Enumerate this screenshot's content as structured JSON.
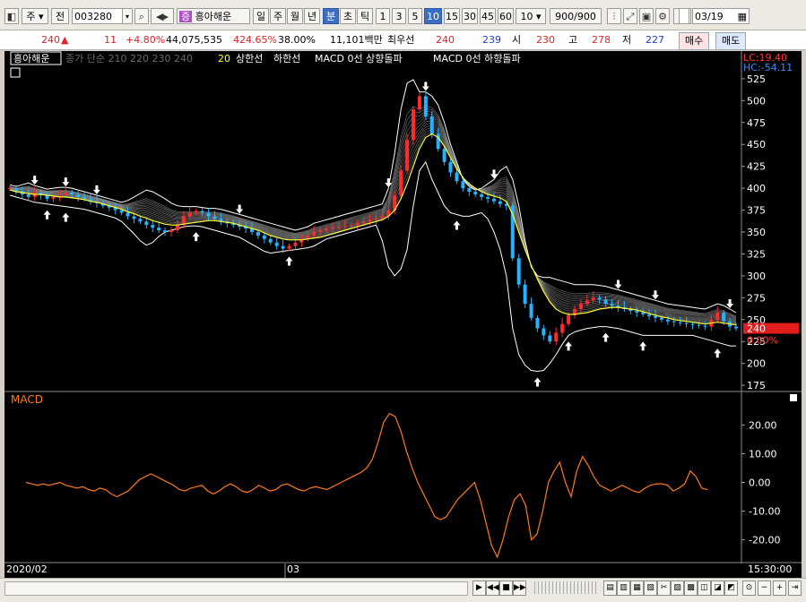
{
  "toolbar": {
    "market_select": "주",
    "prev_label": "전",
    "code_value": "003280",
    "stock_name": "흥아해운",
    "stock_badge": "증",
    "period_buttons": [
      "일",
      "주",
      "월",
      "년"
    ],
    "type_buttons": [
      "분",
      "초",
      "틱"
    ],
    "type_selected": "분",
    "interval_buttons": [
      "1",
      "3",
      "5",
      "10",
      "15",
      "30",
      "45",
      "60"
    ],
    "interval_selected": "10",
    "interval_select_value": "10",
    "count_display": "900/900",
    "date_value": "03/19"
  },
  "quote": {
    "price": "240",
    "change_arrow": "▲",
    "change": "11",
    "change_pct": "+4.80%",
    "volume": "44,075,535",
    "volume_ratio": "424.65%",
    "turnover": "38.00%",
    "amount": "11,101백만",
    "best_bid_label": "최우선",
    "best_ask": "240",
    "best_bid": "239",
    "open_label": "시",
    "open": "230",
    "high_label": "고",
    "high": "278",
    "low_label": "저",
    "low": "227",
    "buy_button": "매수",
    "sell_button": "매도"
  },
  "chart_data": [
    {
      "type": "candlestick",
      "panel": "price",
      "legend": [
        "흥아해운",
        "종가 단순 210",
        "220",
        "230",
        "240",
        "20",
        "상한선",
        "하한선",
        "MACD 0선 상향돌파",
        "MACD 0선 하향돌파"
      ],
      "hc_lc": [
        "LC:19.40",
        "HC:-54.11"
      ],
      "ylim": [
        170,
        530
      ],
      "yticks": [
        175,
        200,
        225,
        250,
        275,
        300,
        325,
        350,
        375,
        400,
        425,
        450,
        475,
        500,
        525
      ],
      "current_price_tag": "240",
      "current_pct_tag": "0.00%",
      "close_series": [
        400,
        397,
        393,
        390,
        395,
        392,
        388,
        390,
        392,
        395,
        393,
        390,
        388,
        385,
        383,
        380,
        378,
        375,
        372,
        368,
        365,
        362,
        358,
        355,
        352,
        350,
        352,
        358,
        368,
        372,
        374,
        372,
        368,
        365,
        362,
        360,
        358,
        356,
        354,
        350,
        346,
        342,
        338,
        334,
        331,
        334,
        338,
        342,
        346,
        350,
        352,
        354,
        355,
        356,
        357,
        358,
        360,
        362,
        364,
        366,
        368,
        375,
        392,
        420,
        455,
        490,
        505,
        482,
        462,
        445,
        430,
        418,
        408,
        400,
        396,
        393,
        390,
        388,
        385,
        382,
        380,
        320,
        290,
        268,
        252,
        240,
        232,
        225,
        235,
        245,
        255,
        262,
        268,
        272,
        275,
        273,
        268,
        266,
        264,
        262,
        260,
        258,
        256,
        254,
        252,
        250,
        248,
        247,
        246,
        245,
        244,
        243,
        242,
        250,
        258,
        248,
        242,
        240
      ],
      "ma20_series": [
        398,
        396,
        395,
        394,
        393,
        393,
        392,
        391,
        390,
        390,
        389,
        388,
        387,
        385,
        384,
        382,
        380,
        378,
        376,
        373,
        371,
        368,
        366,
        363,
        361,
        359,
        358,
        358,
        359,
        360,
        361,
        362,
        363,
        363,
        362,
        361,
        360,
        358,
        356,
        354,
        352,
        349,
        346,
        344,
        342,
        341,
        341,
        341,
        342,
        343,
        344,
        346,
        348,
        350,
        352,
        354,
        356,
        358,
        360,
        362,
        364,
        368,
        375,
        388,
        405,
        425,
        445,
        458,
        462,
        458,
        448,
        435,
        422,
        412,
        405,
        400,
        396,
        393,
        391,
        389,
        385,
        370,
        350,
        330,
        312,
        296,
        282,
        270,
        262,
        258,
        256,
        256,
        257,
        258,
        260,
        262,
        263,
        264,
        264,
        263,
        262,
        261,
        259,
        257,
        255,
        253,
        252,
        250,
        249,
        248,
        247,
        246,
        245,
        246,
        247,
        246,
        245,
        244
      ],
      "upper_band": [
        404,
        402,
        404,
        406,
        403,
        401,
        399,
        400,
        401,
        401,
        400,
        398,
        396,
        394,
        392,
        390,
        388,
        386,
        384,
        386,
        390,
        394,
        398,
        396,
        392,
        388,
        383,
        380,
        379,
        379,
        379,
        378,
        377,
        377,
        376,
        374,
        372,
        370,
        368,
        366,
        364,
        362,
        360,
        358,
        356,
        354,
        352,
        354,
        356,
        360,
        362,
        364,
        366,
        368,
        370,
        372,
        374,
        376,
        378,
        380,
        382,
        400,
        440,
        490,
        520,
        524,
        510,
        510,
        505,
        495,
        475,
        450,
        430,
        410,
        402,
        398,
        400,
        405,
        410,
        420,
        425,
        410,
        380,
        340,
        310,
        300,
        298,
        298,
        296,
        294,
        292,
        290,
        290,
        290,
        290,
        289,
        288,
        286,
        284,
        282,
        280,
        278,
        276,
        274,
        272,
        270,
        268,
        267,
        266,
        265,
        264,
        263,
        262,
        265,
        268,
        266,
        262,
        258
      ],
      "lower_band": [
        392,
        390,
        388,
        386,
        384,
        383,
        382,
        381,
        380,
        379,
        378,
        377,
        376,
        374,
        372,
        370,
        368,
        366,
        362,
        355,
        348,
        340,
        335,
        338,
        345,
        350,
        352,
        354,
        356,
        357,
        357,
        356,
        354,
        352,
        350,
        348,
        346,
        344,
        340,
        336,
        332,
        328,
        326,
        327,
        328,
        329,
        330,
        331,
        332,
        334,
        338,
        342,
        344,
        346,
        348,
        350,
        352,
        354,
        356,
        358,
        340,
        310,
        300,
        308,
        330,
        380,
        420,
        430,
        410,
        395,
        380,
        372,
        370,
        368,
        368,
        370,
        372,
        365,
        350,
        330,
        300,
        240,
        210,
        198,
        192,
        191,
        192,
        200,
        210,
        222,
        232,
        236,
        238,
        240,
        241,
        242,
        242,
        241,
        240,
        238,
        236,
        234,
        232,
        232,
        232,
        232,
        232,
        232,
        232,
        232,
        232,
        230,
        228,
        226,
        224,
        222,
        220,
        220
      ],
      "buy_signals": [
        6,
        9,
        30,
        45,
        72,
        85,
        90,
        96,
        102,
        114
      ],
      "sell_signals": [
        4,
        9,
        14,
        37,
        61,
        67,
        78,
        98,
        104,
        116
      ]
    },
    {
      "type": "line",
      "panel": "macd",
      "title": "MACD",
      "ylim": [
        -27,
        27
      ],
      "yticks": [
        20,
        10,
        0,
        -10,
        -20
      ],
      "ytick_labels": [
        "20.00",
        "10.00",
        "0.00",
        "-10.00",
        "-20.00"
      ],
      "color": "#ff7a1a",
      "values": [
        0,
        -0.5,
        -1,
        -0.5,
        -1,
        -0.5,
        0,
        -1,
        -1.5,
        -2,
        -1.5,
        -2.5,
        -3,
        -2,
        -2.5,
        -4,
        -5,
        -4,
        -3,
        -1,
        1,
        2,
        3,
        2,
        1,
        0,
        -1,
        -2.5,
        -3,
        -2,
        -1.5,
        -1,
        -3,
        -4,
        -3,
        -1.5,
        -0.5,
        -1.5,
        -3,
        -3.5,
        -2.5,
        -1,
        -2,
        -3,
        -2.5,
        -1,
        -0.5,
        -1.5,
        -2.5,
        -3,
        -2,
        -1.5,
        -2,
        -2.5,
        -1.5,
        -0.5,
        0.5,
        1.5,
        2.5,
        3.5,
        5,
        8,
        14,
        21,
        24,
        23,
        18,
        11,
        5,
        0,
        -4,
        -8,
        -12,
        -13,
        -12,
        -9,
        -6,
        -4,
        -2,
        0,
        -6,
        -14,
        -22,
        -26,
        -20,
        -12,
        -6,
        -4,
        -8,
        -20,
        -18,
        -10,
        0,
        4,
        7,
        0,
        -5,
        4,
        9,
        6,
        2,
        -1,
        -2,
        -3,
        -2,
        -1,
        -2,
        -3,
        -3.5,
        -2,
        -1,
        -0.5,
        -0.5,
        -1,
        -3,
        -2,
        -0.5,
        4,
        2,
        -2,
        -2.5
      ]
    }
  ],
  "axis": {
    "x_labels": [
      "2020/02",
      "03"
    ],
    "time_label": "15:30:00"
  },
  "colors": {
    "up": "#ff2a2a",
    "down": "#23b4ff",
    "ma": "#ffff33",
    "band": "#ffffff",
    "ma_fan": "#9a9a9a",
    "macd": "#ff7a1a",
    "price_tag_bg": "#e21b1b"
  }
}
